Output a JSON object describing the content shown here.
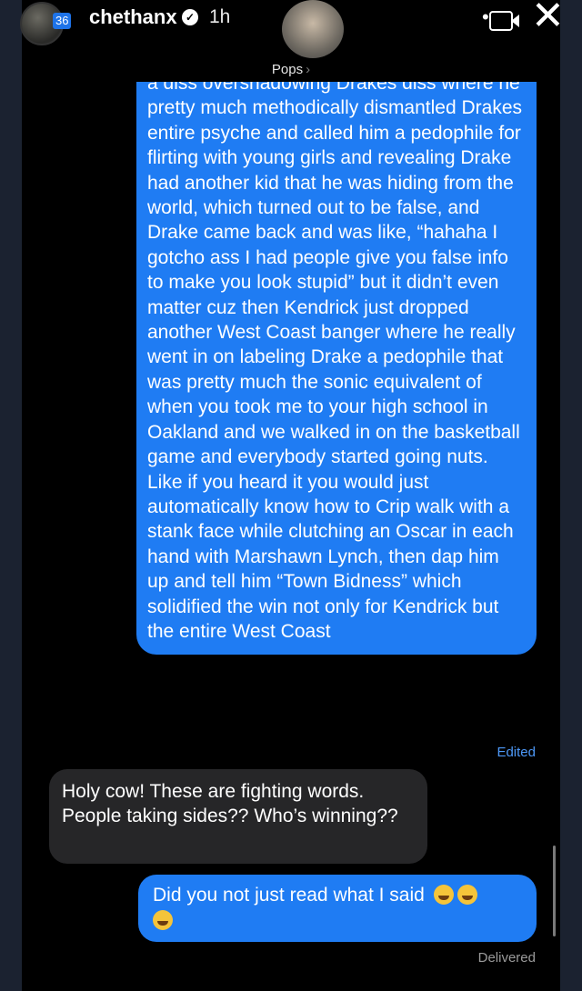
{
  "story": {
    "badge": "36",
    "username": "chethanx",
    "verified_mark": "✓",
    "time_ago": "1h",
    "more_icon": "•••",
    "close_icon": "✕"
  },
  "conversation": {
    "contact_name": "Pops",
    "contact_chevron": "›",
    "outgoing_message_1": "a diss overshadowing Drakes diss where he pretty much methodically dismantled Drakes entire psyche and called him a pedophile for flirting with young girls and revealing Drake had another kid that he was hiding from the world, which turned out to be false, and Drake came back and was like, “hahaha I gotcho ass I had people give you false info to make you look stupid” but it didn’t even matter cuz then Kendrick just dropped another West Coast banger where he really went in on labeling Drake a pedophile that was pretty much the sonic equivalent of when you took me to your high school in Oakland and we walked in on the basketball game and everybody started going nuts. Like if you heard it you would just automatically know how to Crip walk with a stank face while clutching an Oscar in each hand with Marshawn Lynch, then dap him up and tell him “Town Bidness” which solidified the win not only for Kendrick but the entire West Coast",
    "edited_label": "Edited",
    "incoming_message": "Holy cow! These are fighting words. People taking sides?? Who’s winning??",
    "outgoing_message_2": "Did you not just read what I said",
    "delivered_label": "Delivered"
  },
  "colors": {
    "imessage_blue": "#1f7cf3",
    "incoming_gray": "#262628"
  }
}
